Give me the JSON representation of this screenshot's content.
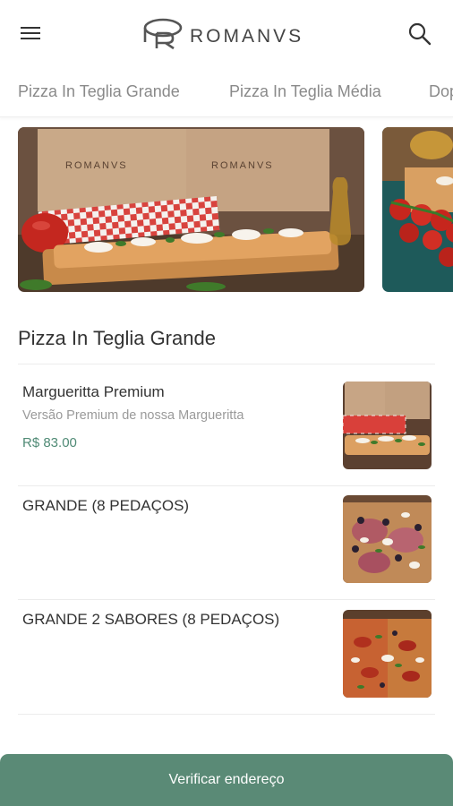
{
  "header": {
    "brand": "ROMANVS",
    "menu_icon": "hamburger-menu-icon",
    "search_icon": "search-icon"
  },
  "categories": [
    {
      "label": "Pizza In Teglia Grande"
    },
    {
      "label": "Pizza In Teglia Média"
    },
    {
      "label": "Dop"
    }
  ],
  "banners": [
    {
      "image": "pizza-boxes-photo",
      "box_brand": "ROMANVS"
    },
    {
      "image": "pizza-tomatoes-photo"
    }
  ],
  "section": {
    "title": "Pizza In Teglia Grande"
  },
  "items": [
    {
      "name": "Margueritta Premium",
      "description": "Versão Premium de nossa Margueritta",
      "price": "R$ 83.00",
      "image": "margherita-pizza-photo"
    },
    {
      "name": "GRANDE (8 PEDAÇOS)",
      "image": "grande-pizza-photo"
    },
    {
      "name": "GRANDE 2 SABORES (8 PEDAÇOS)",
      "image": "two-flavors-pizza-photo"
    }
  ],
  "cta": {
    "label": "Verificar endereço"
  },
  "colors": {
    "accent": "#5a8a76",
    "price": "#4f8a75"
  }
}
